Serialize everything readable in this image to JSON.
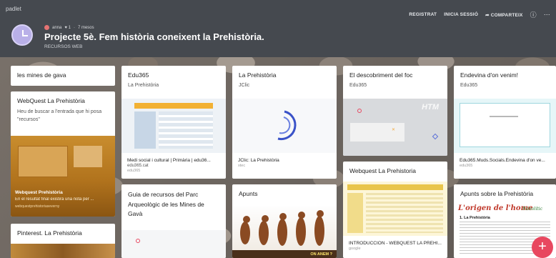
{
  "app": {
    "brand": "padlet"
  },
  "topbar": {
    "register": "REGISTRAT",
    "login": "INICIA SESSIÓ",
    "share": "COMPARTEIX",
    "share_icon": "share-icon",
    "help_icon": "help-icon",
    "more_icon": "more-icon"
  },
  "header": {
    "author": "anna",
    "likes": "♥ 1",
    "separator": "·",
    "age": "7 mesos",
    "title": "Projecte 5è. Fem història coneixent la Prehistòria.",
    "subtitle": "RECURSOS WEB"
  },
  "columns": [
    {
      "cards": [
        {
          "title": "les mines de gava"
        },
        {
          "title": "WebQuest La Prehistòria",
          "body": "Heu de buscar a l'entrada que hi posa \"recursos\"",
          "link_title": "Webquest Prehistòria",
          "link_desc": "En el resultat final existirà una nota per ...",
          "link_host": "webquestprehistoriaseverny"
        },
        {
          "title": "Pinterest. La Prehistòria"
        }
      ]
    },
    {
      "cards": [
        {
          "title": "Edu365",
          "sub": "La Prehistòria",
          "link_title": "Medi social i cultural | Primària | edu36...",
          "link_desc": "edu365.cat",
          "link_host": "edu365"
        },
        {
          "title": "Guia de recursos del Parc Arqueològic de les Mines de Gavà"
        }
      ]
    },
    {
      "cards": [
        {
          "title": "La Prehistòria",
          "sub": "JClic",
          "link_title": "JClic: La Prehistòria",
          "link_host": "xtec"
        },
        {
          "title": "Apunts",
          "thumb_text": "ON ANEM ?"
        }
      ]
    },
    {
      "cards": [
        {
          "title": "El descobriment del foc",
          "sub": "Edu365",
          "thumb_text": "HTM"
        },
        {
          "title": "Webquest La Prehistoria",
          "link_title": "INTRODUCCION - WEBQUEST LA PREHI...",
          "link_host": "google"
        }
      ]
    },
    {
      "cards": [
        {
          "title": "Endevina d'on venim!",
          "sub": "Edu365",
          "link_title": "Edu365.Muds.Socials.Endevina d'on ve...",
          "link_host": "edu365"
        },
        {
          "title": "Apunts sobre la Prehistòria",
          "doc_heading": "L'origen de l'home",
          "doc_tag": "Paleolític",
          "doc_section": "1. La Prehistòria"
        }
      ]
    }
  ],
  "fab": {
    "label": "+"
  }
}
